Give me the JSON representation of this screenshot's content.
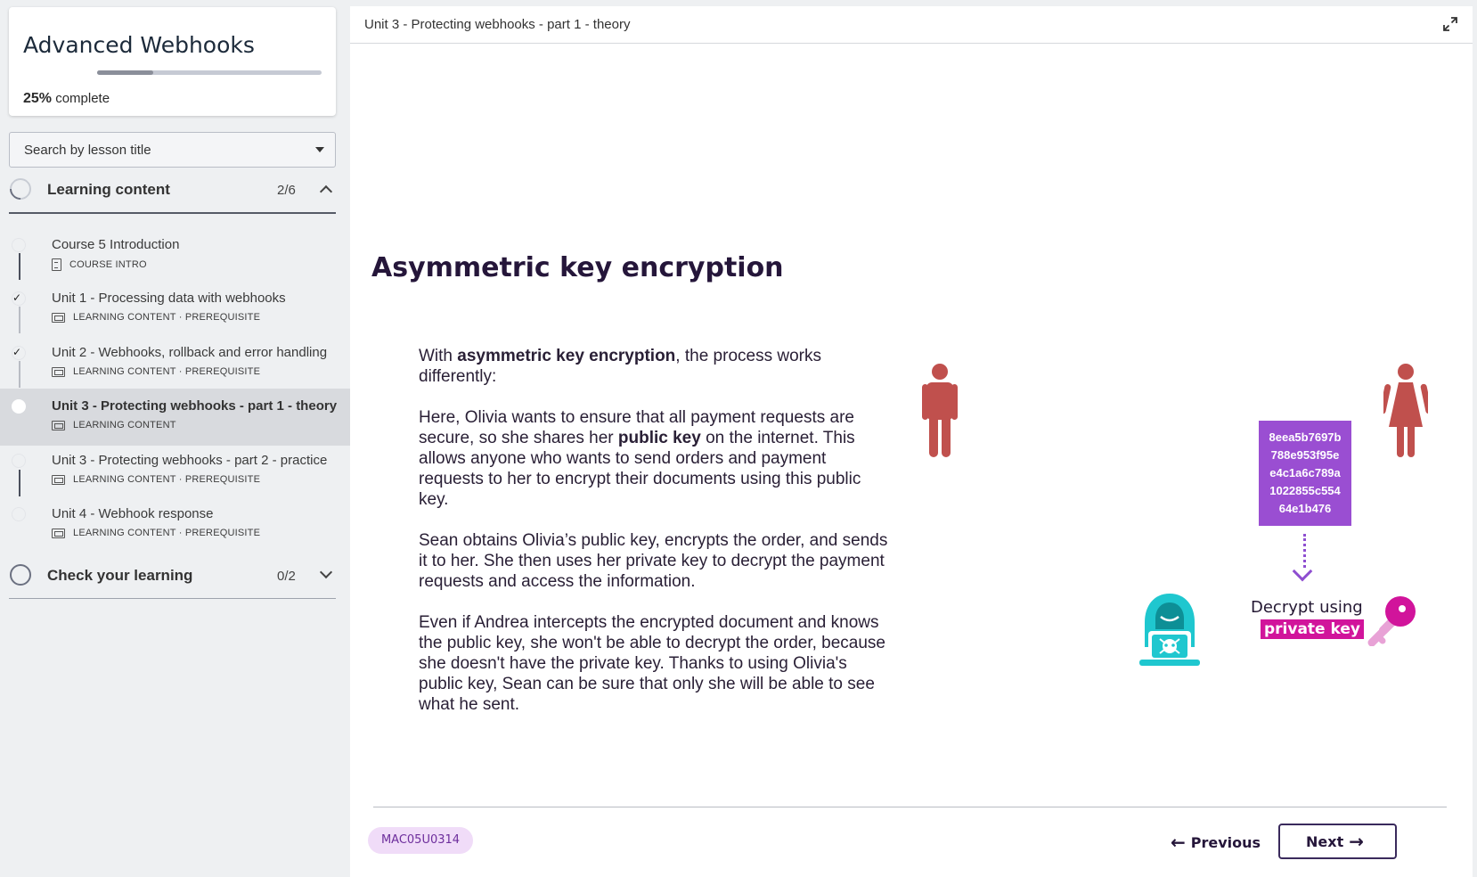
{
  "course": {
    "title": "Advanced Webhooks",
    "progress_percent": 25,
    "progress_value": "25%",
    "progress_suffix": "complete"
  },
  "search": {
    "label": "Search by lesson title"
  },
  "sections": [
    {
      "title": "Learning content",
      "count": "2/6",
      "expanded": true
    },
    {
      "title": "Check your learning",
      "count": "0/2",
      "expanded": false
    }
  ],
  "lessons": [
    {
      "name": "Course 5 Introduction",
      "meta": "COURSE INTRO",
      "icon": "document-icon",
      "completed": false,
      "active": false
    },
    {
      "name": "Unit 1 - Processing data with webhooks",
      "meta": "LEARNING CONTENT · PREREQUISITE",
      "icon": "slides-icon",
      "completed": true,
      "active": false
    },
    {
      "name": "Unit 2 - Webhooks, rollback and error handling",
      "meta": "LEARNING CONTENT · PREREQUISITE",
      "icon": "slides-icon",
      "completed": true,
      "active": false
    },
    {
      "name": "Unit 3 - Protecting webhooks - part 1 - theory",
      "meta": "LEARNING CONTENT",
      "icon": "slides-icon",
      "completed": false,
      "active": true
    },
    {
      "name": "Unit 3 - Protecting webhooks - part 2 - practice",
      "meta": "LEARNING CONTENT · PREREQUISITE",
      "icon": "slides-icon",
      "completed": false,
      "active": false
    },
    {
      "name": "Unit 4 - Webhook response",
      "meta": "LEARNING CONTENT · PREREQUISITE",
      "icon": "slides-icon",
      "completed": false,
      "active": false
    }
  ],
  "main": {
    "header_title": "Unit 3 - Protecting webhooks - part 1 - theory",
    "slide": {
      "heading": "Asymmetric key encryption",
      "p1_a": "With ",
      "p1_b": "asymmetric key encryption",
      "p1_c": ", the process works differently:",
      "p2_a": "Here, Olivia wants to ensure that all payment requests are secure, so she shares her ",
      "p2_b": "public key",
      "p2_c": " on the internet. This allows anyone who wants to send orders and payment requests to her to encrypt their documents using this public key.",
      "p3": "Sean obtains Olivia’s public key, encrypts the order, and sends it to her. She then uses her private key to decrypt the payment requests and access the information.",
      "p4": "Even if Andrea intercepts the encrypted document and knows the public key, she won't be able to decrypt the order, because she doesn't have the private key. Thanks to using Olivia's public key, Sean can be sure that only she will be able to see what he sent.",
      "cipher_lines": [
        "8eea5b7697b",
        "788e953f95e",
        "e4c1a6c789a",
        "1022855c554",
        "64e1b476"
      ],
      "decrypt_line1": "Decrypt using",
      "decrypt_line2": "private key"
    },
    "footer": {
      "code": "MAC05U0314",
      "previous_label": "Previous",
      "next_label": "Next"
    }
  },
  "colors": {
    "person": "#c0504d",
    "cipher_box": "#9a4ed2",
    "private_key_highlight": "#d1149b",
    "hacker": "#1fc7cf",
    "badge_bg": "#f0dcf8"
  },
  "icons": {
    "expand": "expand-icon",
    "previous": "arrow-left-icon",
    "next": "arrow-right-icon",
    "key": "key-icon",
    "hacker": "hacker-icon"
  }
}
